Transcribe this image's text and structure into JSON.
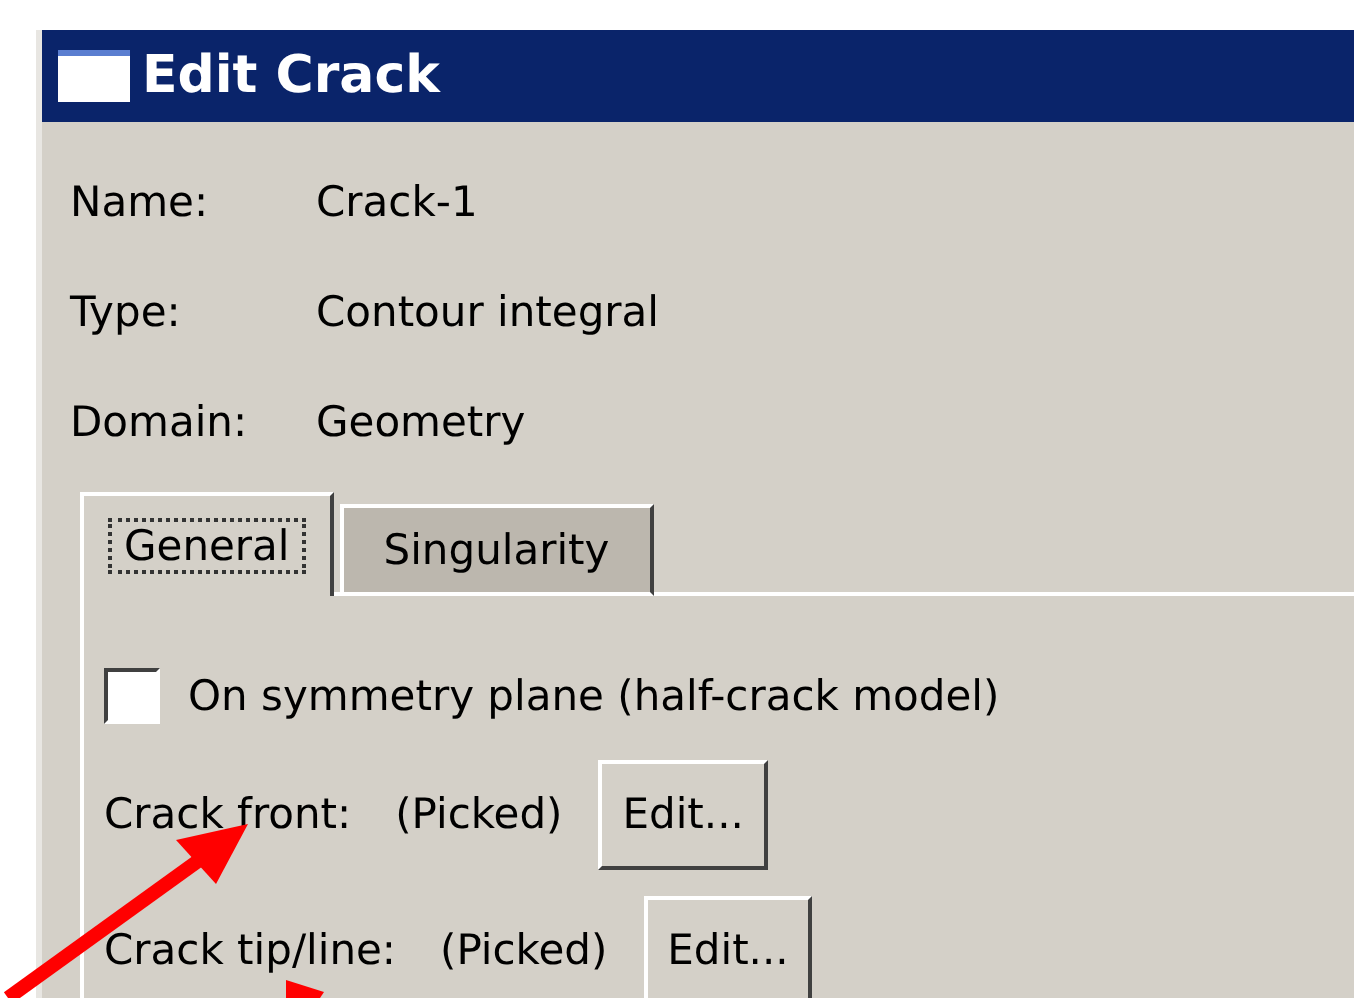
{
  "window": {
    "title": "Edit Crack"
  },
  "fields": [
    {
      "label": "Name:",
      "value": "Crack-1"
    },
    {
      "label": "Type:",
      "value": "Contour integral"
    },
    {
      "label": "Domain:",
      "value": "Geometry"
    }
  ],
  "tabs": [
    {
      "label": "General",
      "selected": true
    },
    {
      "label": "Singularity",
      "selected": false
    }
  ],
  "symmetry": {
    "label": "On symmetry plane (half-crack model)",
    "checked": false
  },
  "picks": [
    {
      "label": "Crack front:",
      "value": "(Picked)",
      "button": "Edit..."
    },
    {
      "label": "Crack tip/line:",
      "value": "(Picked)",
      "button": "Edit..."
    }
  ]
}
